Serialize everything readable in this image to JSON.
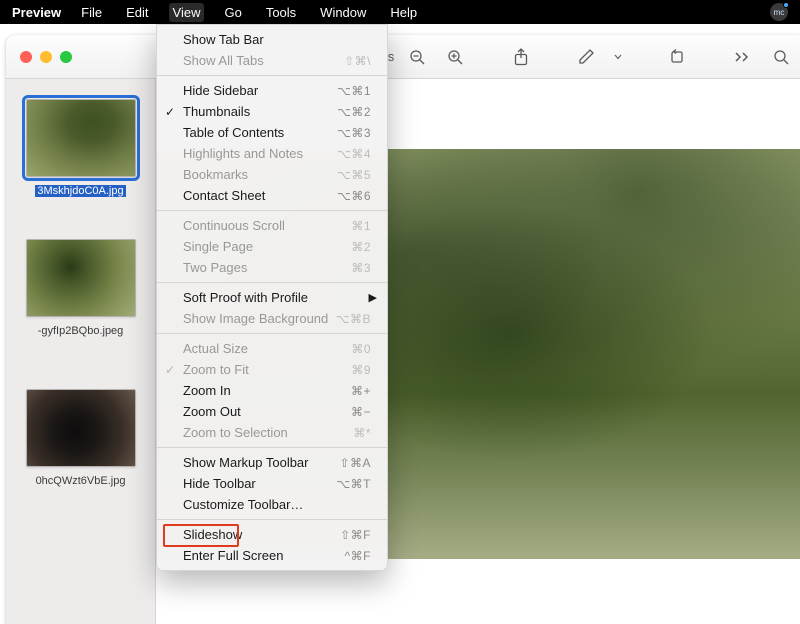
{
  "menubar": {
    "app": "Preview",
    "items": [
      "File",
      "Edit",
      "View",
      "Go",
      "Tools",
      "Window",
      "Help"
    ],
    "active_index": 2
  },
  "window": {
    "title_partial": "ages"
  },
  "toolbar": {
    "icons": [
      "zoom-out",
      "zoom-in",
      "share",
      "markup",
      "more",
      "rotate",
      "overflow",
      "search"
    ]
  },
  "sidebar": {
    "thumbs": [
      {
        "caption": "3MskhjdoC0A.jpg",
        "art": "art-pine1",
        "selected": true
      },
      {
        "caption": "-gyfIp2BQbo.jpeg",
        "art": "art-pine2",
        "selected": false
      },
      {
        "caption": "0hcQWzt6VbE.jpg",
        "art": "art-cat",
        "selected": false
      }
    ]
  },
  "view_menu": {
    "groups": [
      [
        {
          "label": "Show Tab Bar",
          "shortcut": "",
          "enabled": true
        },
        {
          "label": "Show All Tabs",
          "shortcut": "⇧⌘\\",
          "enabled": false
        }
      ],
      [
        {
          "label": "Hide Sidebar",
          "shortcut": "⌥⌘1",
          "enabled": true
        },
        {
          "label": "Thumbnails",
          "shortcut": "⌥⌘2",
          "enabled": true,
          "checked": true
        },
        {
          "label": "Table of Contents",
          "shortcut": "⌥⌘3",
          "enabled": true
        },
        {
          "label": "Highlights and Notes",
          "shortcut": "⌥⌘4",
          "enabled": false
        },
        {
          "label": "Bookmarks",
          "shortcut": "⌥⌘5",
          "enabled": false
        },
        {
          "label": "Contact Sheet",
          "shortcut": "⌥⌘6",
          "enabled": true
        }
      ],
      [
        {
          "label": "Continuous Scroll",
          "shortcut": "⌘1",
          "enabled": false
        },
        {
          "label": "Single Page",
          "shortcut": "⌘2",
          "enabled": false
        },
        {
          "label": "Two Pages",
          "shortcut": "⌘3",
          "enabled": false
        }
      ],
      [
        {
          "label": "Soft Proof with Profile",
          "shortcut": "",
          "enabled": true,
          "submenu": true
        },
        {
          "label": "Show Image Background",
          "shortcut": "⌥⌘B",
          "enabled": false
        }
      ],
      [
        {
          "label": "Actual Size",
          "shortcut": "⌘0",
          "enabled": false
        },
        {
          "label": "Zoom to Fit",
          "shortcut": "⌘9",
          "enabled": false,
          "checked_dim": true
        },
        {
          "label": "Zoom In",
          "shortcut": "⌘+",
          "enabled": true
        },
        {
          "label": "Zoom Out",
          "shortcut": "⌘−",
          "enabled": true
        },
        {
          "label": "Zoom to Selection",
          "shortcut": "⌘*",
          "enabled": false
        }
      ],
      [
        {
          "label": "Show Markup Toolbar",
          "shortcut": "⇧⌘A",
          "enabled": true
        },
        {
          "label": "Hide Toolbar",
          "shortcut": "⌥⌘T",
          "enabled": true
        },
        {
          "label": "Customize Toolbar…",
          "shortcut": "",
          "enabled": true
        }
      ],
      [
        {
          "label": "Slideshow",
          "shortcut": "⇧⌘F",
          "enabled": true,
          "highlighted": true
        },
        {
          "label": "Enter Full Screen",
          "shortcut": "^⌘F",
          "enabled": true
        }
      ]
    ]
  }
}
